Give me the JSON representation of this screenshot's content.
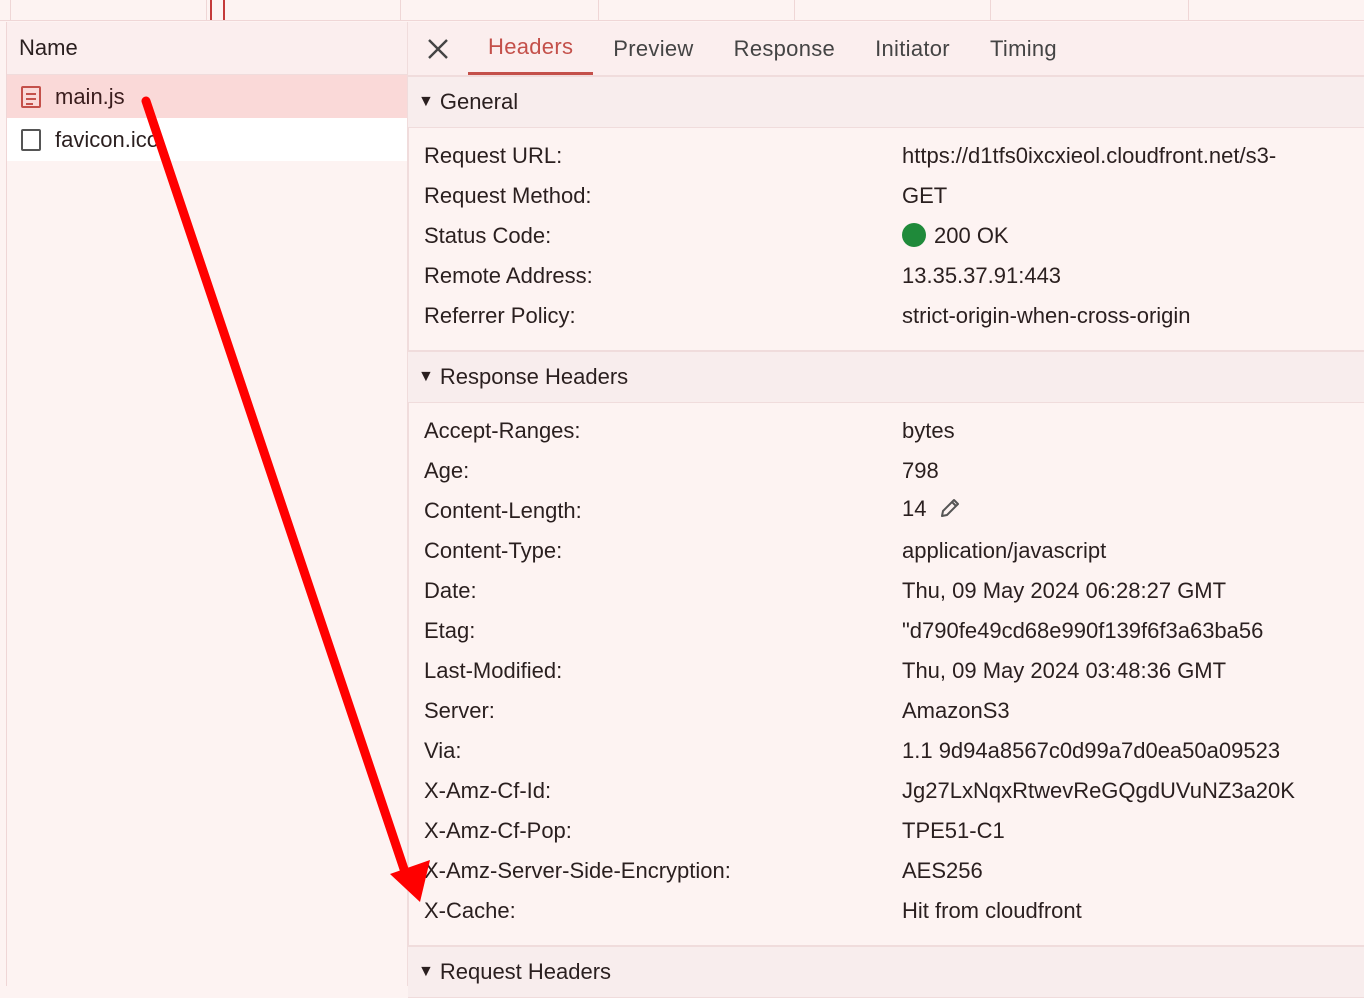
{
  "sidebar": {
    "header": "Name",
    "requests": [
      {
        "name": "main.js",
        "icon": "script-file-icon",
        "selected": true
      },
      {
        "name": "favicon.ico",
        "icon": "blank-file-icon",
        "selected": false
      }
    ]
  },
  "tabs": {
    "close_icon": "close-icon",
    "items": [
      "Headers",
      "Preview",
      "Response",
      "Initiator",
      "Timing"
    ],
    "active": "Headers"
  },
  "general": {
    "title": "General",
    "rows": [
      {
        "key": "Request URL:",
        "value": "https://d1tfs0ixcxieol.cloudfront.net/s3-"
      },
      {
        "key": "Request Method:",
        "value": "GET"
      },
      {
        "key": "Status Code:",
        "value": "200 OK"
      },
      {
        "key": "Remote Address:",
        "value": "13.35.37.91:443"
      },
      {
        "key": "Referrer Policy:",
        "value": "strict-origin-when-cross-origin"
      }
    ]
  },
  "response_headers": {
    "title": "Response Headers",
    "rows": [
      {
        "key": "Accept-Ranges:",
        "value": "bytes"
      },
      {
        "key": "Age:",
        "value": "798"
      },
      {
        "key": "Content-Length:",
        "value": "14"
      },
      {
        "key": "Content-Type:",
        "value": "application/javascript"
      },
      {
        "key": "Date:",
        "value": "Thu, 09 May 2024 06:28:27 GMT"
      },
      {
        "key": "Etag:",
        "value": "\"d790fe49cd68e990f139f6f3a63ba56"
      },
      {
        "key": "Last-Modified:",
        "value": "Thu, 09 May 2024 03:48:36 GMT"
      },
      {
        "key": "Server:",
        "value": "AmazonS3"
      },
      {
        "key": "Via:",
        "value": "1.1 9d94a8567c0d99a7d0ea50a09523"
      },
      {
        "key": "X-Amz-Cf-Id:",
        "value": "Jg27LxNqxRtwevReGQgdUVuNZ3a20K"
      },
      {
        "key": "X-Amz-Cf-Pop:",
        "value": "TPE51-C1"
      },
      {
        "key": "X-Amz-Server-Side-Encryption:",
        "value": "AES256"
      },
      {
        "key": "X-Cache:",
        "value": "Hit from cloudfront"
      }
    ]
  },
  "request_headers": {
    "title": "Request Headers"
  },
  "colors": {
    "accent": "#c4504a",
    "status_ok": "#1f8a3a",
    "annotation": "#ff0000"
  }
}
